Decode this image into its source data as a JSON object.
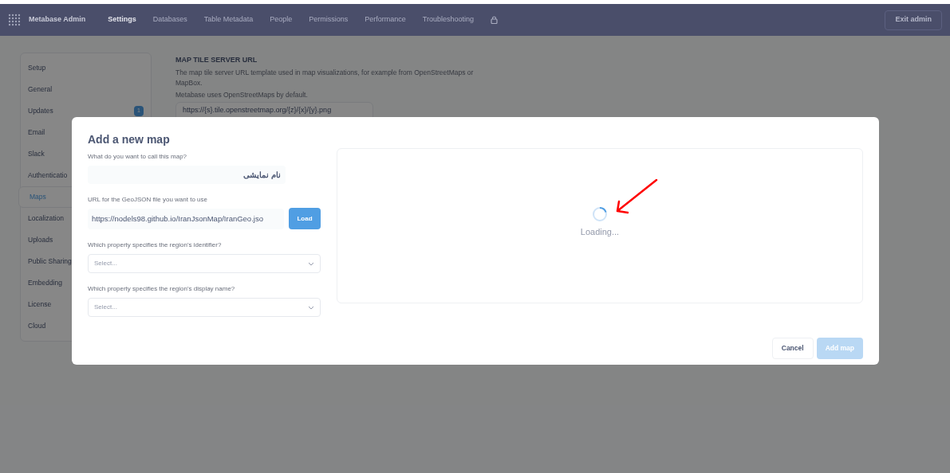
{
  "header": {
    "brand": "Metabase Admin",
    "nav": [
      {
        "label": "Settings",
        "selected": true
      },
      {
        "label": "Databases",
        "selected": false
      },
      {
        "label": "Table Metadata",
        "selected": false
      },
      {
        "label": "People",
        "selected": false
      },
      {
        "label": "Permissions",
        "selected": false
      },
      {
        "label": "Performance",
        "selected": false
      },
      {
        "label": "Troubleshooting",
        "selected": false
      }
    ],
    "exit_button": "Exit admin"
  },
  "sidebar": {
    "items": [
      {
        "label": "Setup",
        "selected": false
      },
      {
        "label": "General",
        "selected": false
      },
      {
        "label": "Updates",
        "selected": false,
        "badge": "1"
      },
      {
        "label": "Email",
        "selected": false
      },
      {
        "label": "Slack",
        "selected": false
      },
      {
        "label": "Authenticatio",
        "selected": false
      },
      {
        "label": "Maps",
        "selected": true
      },
      {
        "label": "Localization",
        "selected": false
      },
      {
        "label": "Uploads",
        "selected": false
      },
      {
        "label": "Public Sharing",
        "selected": false
      },
      {
        "label": "Embedding",
        "selected": false
      },
      {
        "label": "License",
        "selected": false
      },
      {
        "label": "Cloud",
        "selected": false
      }
    ]
  },
  "setting": {
    "title": "MAP TILE SERVER URL",
    "description": [
      "The map tile server URL template used in map visualizations, for example from OpenStreetMaps or MapBox.",
      "Metabase uses OpenStreetMaps by default."
    ],
    "value": "https://{s}.tile.openstreetmap.org/{z}/{x}/{y}.png"
  },
  "modal": {
    "title": "Add a new map",
    "name_field": {
      "label": "What do you want to call this map?",
      "value": "نام نمایشی"
    },
    "url_field": {
      "label": "URL for the GeoJSON file you want to use",
      "value": "https://nodels98.github.io/IranJsonMap/IranGeo.jso",
      "button": "Load"
    },
    "selects": [
      {
        "label": "Which property specifies the region's identifier?",
        "placeholder": "Select..."
      },
      {
        "label": "Which property specifies the region's display name?",
        "placeholder": "Select..."
      }
    ],
    "preview": {
      "status": "Loading..."
    },
    "buttons": [
      {
        "label": "Cancel",
        "disabled": false,
        "kind": "secondary"
      },
      {
        "label": "Add map",
        "disabled": true,
        "kind": "primary"
      }
    ]
  }
}
